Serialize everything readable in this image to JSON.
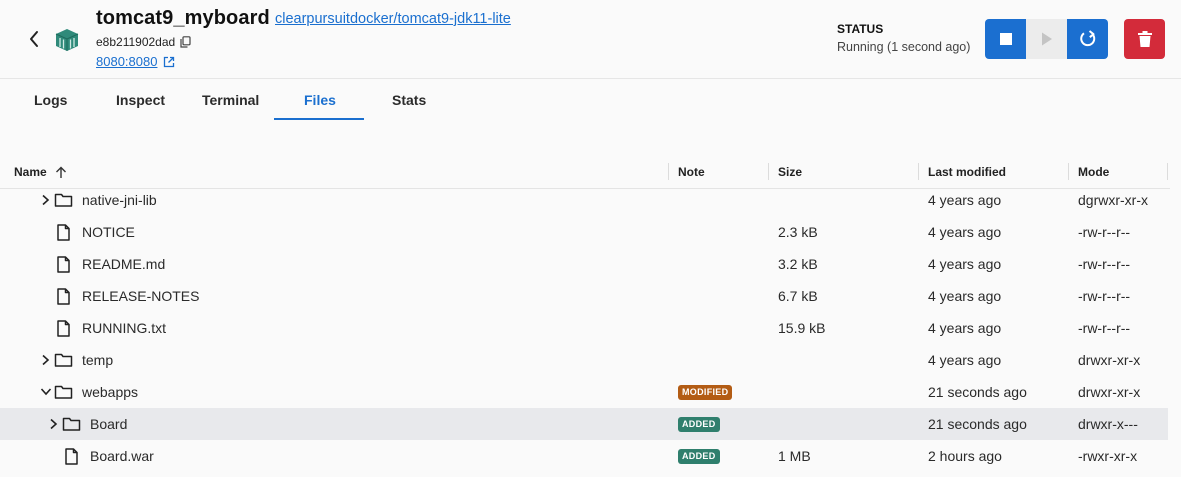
{
  "header": {
    "name": "tomcat9_myboard",
    "image": "clearpursuitdocker/tomcat9-jdk11-lite",
    "container_id": "e8b211902dad",
    "port": "8080:8080",
    "status_label": "STATUS",
    "status_value": "Running (1 second ago)",
    "icons": {
      "back": "chevron-left-icon",
      "container": "container-icon",
      "copy": "copy-icon",
      "external": "external-link-icon",
      "stop": "stop-icon",
      "start": "play-icon",
      "restart": "restart-icon",
      "delete": "trash-icon"
    },
    "colors": {
      "primary": "#1b6fd0",
      "danger": "#d32b3a",
      "link": "#1a6fcf"
    }
  },
  "tabs": [
    "Logs",
    "Inspect",
    "Terminal",
    "Files",
    "Stats"
  ],
  "active_tab": "Files",
  "table": {
    "columns": {
      "name": "Name",
      "note": "Note",
      "size": "Size",
      "modified": "Last modified",
      "mode": "Mode"
    },
    "sort_icon": "arrow-up-icon",
    "rows": [
      {
        "name": "native-jni-lib",
        "type": "folder",
        "expand": "collapsed",
        "note": "",
        "size": "",
        "modified": "4 years ago",
        "mode": "dgrwxr-xr-x"
      },
      {
        "name": "NOTICE",
        "type": "file",
        "note": "",
        "size": "2.3 kB",
        "modified": "4 years ago",
        "mode": "-rw-r--r--"
      },
      {
        "name": "README.md",
        "type": "file",
        "note": "",
        "size": "3.2 kB",
        "modified": "4 years ago",
        "mode": "-rw-r--r--"
      },
      {
        "name": "RELEASE-NOTES",
        "type": "file",
        "note": "",
        "size": "6.7 kB",
        "modified": "4 years ago",
        "mode": "-rw-r--r--"
      },
      {
        "name": "RUNNING.txt",
        "type": "file",
        "note": "",
        "size": "15.9 kB",
        "modified": "4 years ago",
        "mode": "-rw-r--r--"
      },
      {
        "name": "temp",
        "type": "folder",
        "expand": "collapsed",
        "note": "",
        "size": "",
        "modified": "4 years ago",
        "mode": "drwxr-xr-x"
      },
      {
        "name": "webapps",
        "type": "folder",
        "expand": "expanded",
        "note": "MODIFIED",
        "size": "",
        "modified": "21 seconds ago",
        "mode": "drwxr-xr-x"
      },
      {
        "name": "Board",
        "type": "folder",
        "expand": "collapsed",
        "note": "ADDED",
        "size": "",
        "modified": "21 seconds ago",
        "mode": "drwxr-x---",
        "selected": true
      },
      {
        "name": "Board.war",
        "type": "file",
        "note": "ADDED",
        "size": "1 MB",
        "modified": "2 hours ago",
        "mode": "-rwxr-xr-x"
      }
    ]
  }
}
